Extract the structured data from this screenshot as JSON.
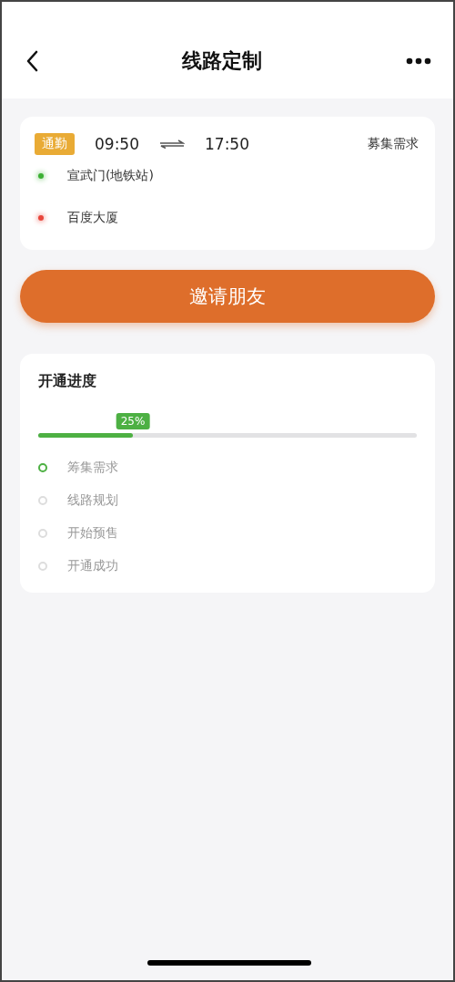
{
  "nav": {
    "title": "线路定制"
  },
  "route": {
    "tag": "通勤",
    "depart": "09:50",
    "return": "17:50",
    "status": "募集需求",
    "stops": [
      {
        "name": "宣武门(地铁站)",
        "color": "#3cb034"
      },
      {
        "name": "百度大厦",
        "color": "#e8443a"
      }
    ]
  },
  "invite_button": "邀请朋友",
  "progress": {
    "title": "开通进度",
    "level": 0.25,
    "reading": "25%",
    "stages": [
      {
        "label": "筹集需求",
        "active": true
      },
      {
        "label": "线路规划",
        "active": false
      },
      {
        "label": "开始预售",
        "active": false
      },
      {
        "label": "开通成功",
        "active": false
      }
    ]
  }
}
